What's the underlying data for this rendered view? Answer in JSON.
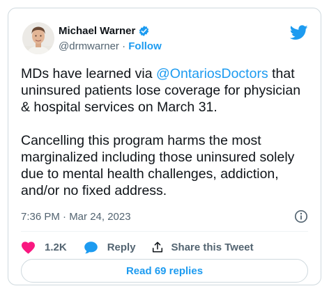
{
  "author": {
    "name": "Michael Warner",
    "handle": "@drmwarner",
    "separator": "·",
    "follow_label": "Follow",
    "verified": true
  },
  "tweet": {
    "paragraph1_before": "MDs have learned via ",
    "mention": "@OntariosDoctors",
    "paragraph1_after": " that uninsured patients lose coverage for physician & hospital services on March 31.",
    "paragraph2": "Cancelling this program harms the most marginalized including those uninsured solely due to mental health challenges, addiction, and/or no fixed address."
  },
  "timestamp": "7:36 PM · Mar 24, 2023",
  "actions": {
    "like_count": "1.2K",
    "reply_label": "Reply",
    "share_label": "Share this Tweet"
  },
  "read_replies_label": "Read 69 replies",
  "icons": {
    "verified": "verified-badge-icon",
    "brand": "twitter-bird-icon",
    "info": "info-icon",
    "like": "heart-icon",
    "reply": "speech-bubble-icon",
    "share": "share-upload-icon"
  },
  "colors": {
    "accent": "#1d9bf0",
    "like": "#f91880",
    "text": "#0f1419",
    "secondary": "#536471",
    "border": "#cfd9de"
  }
}
